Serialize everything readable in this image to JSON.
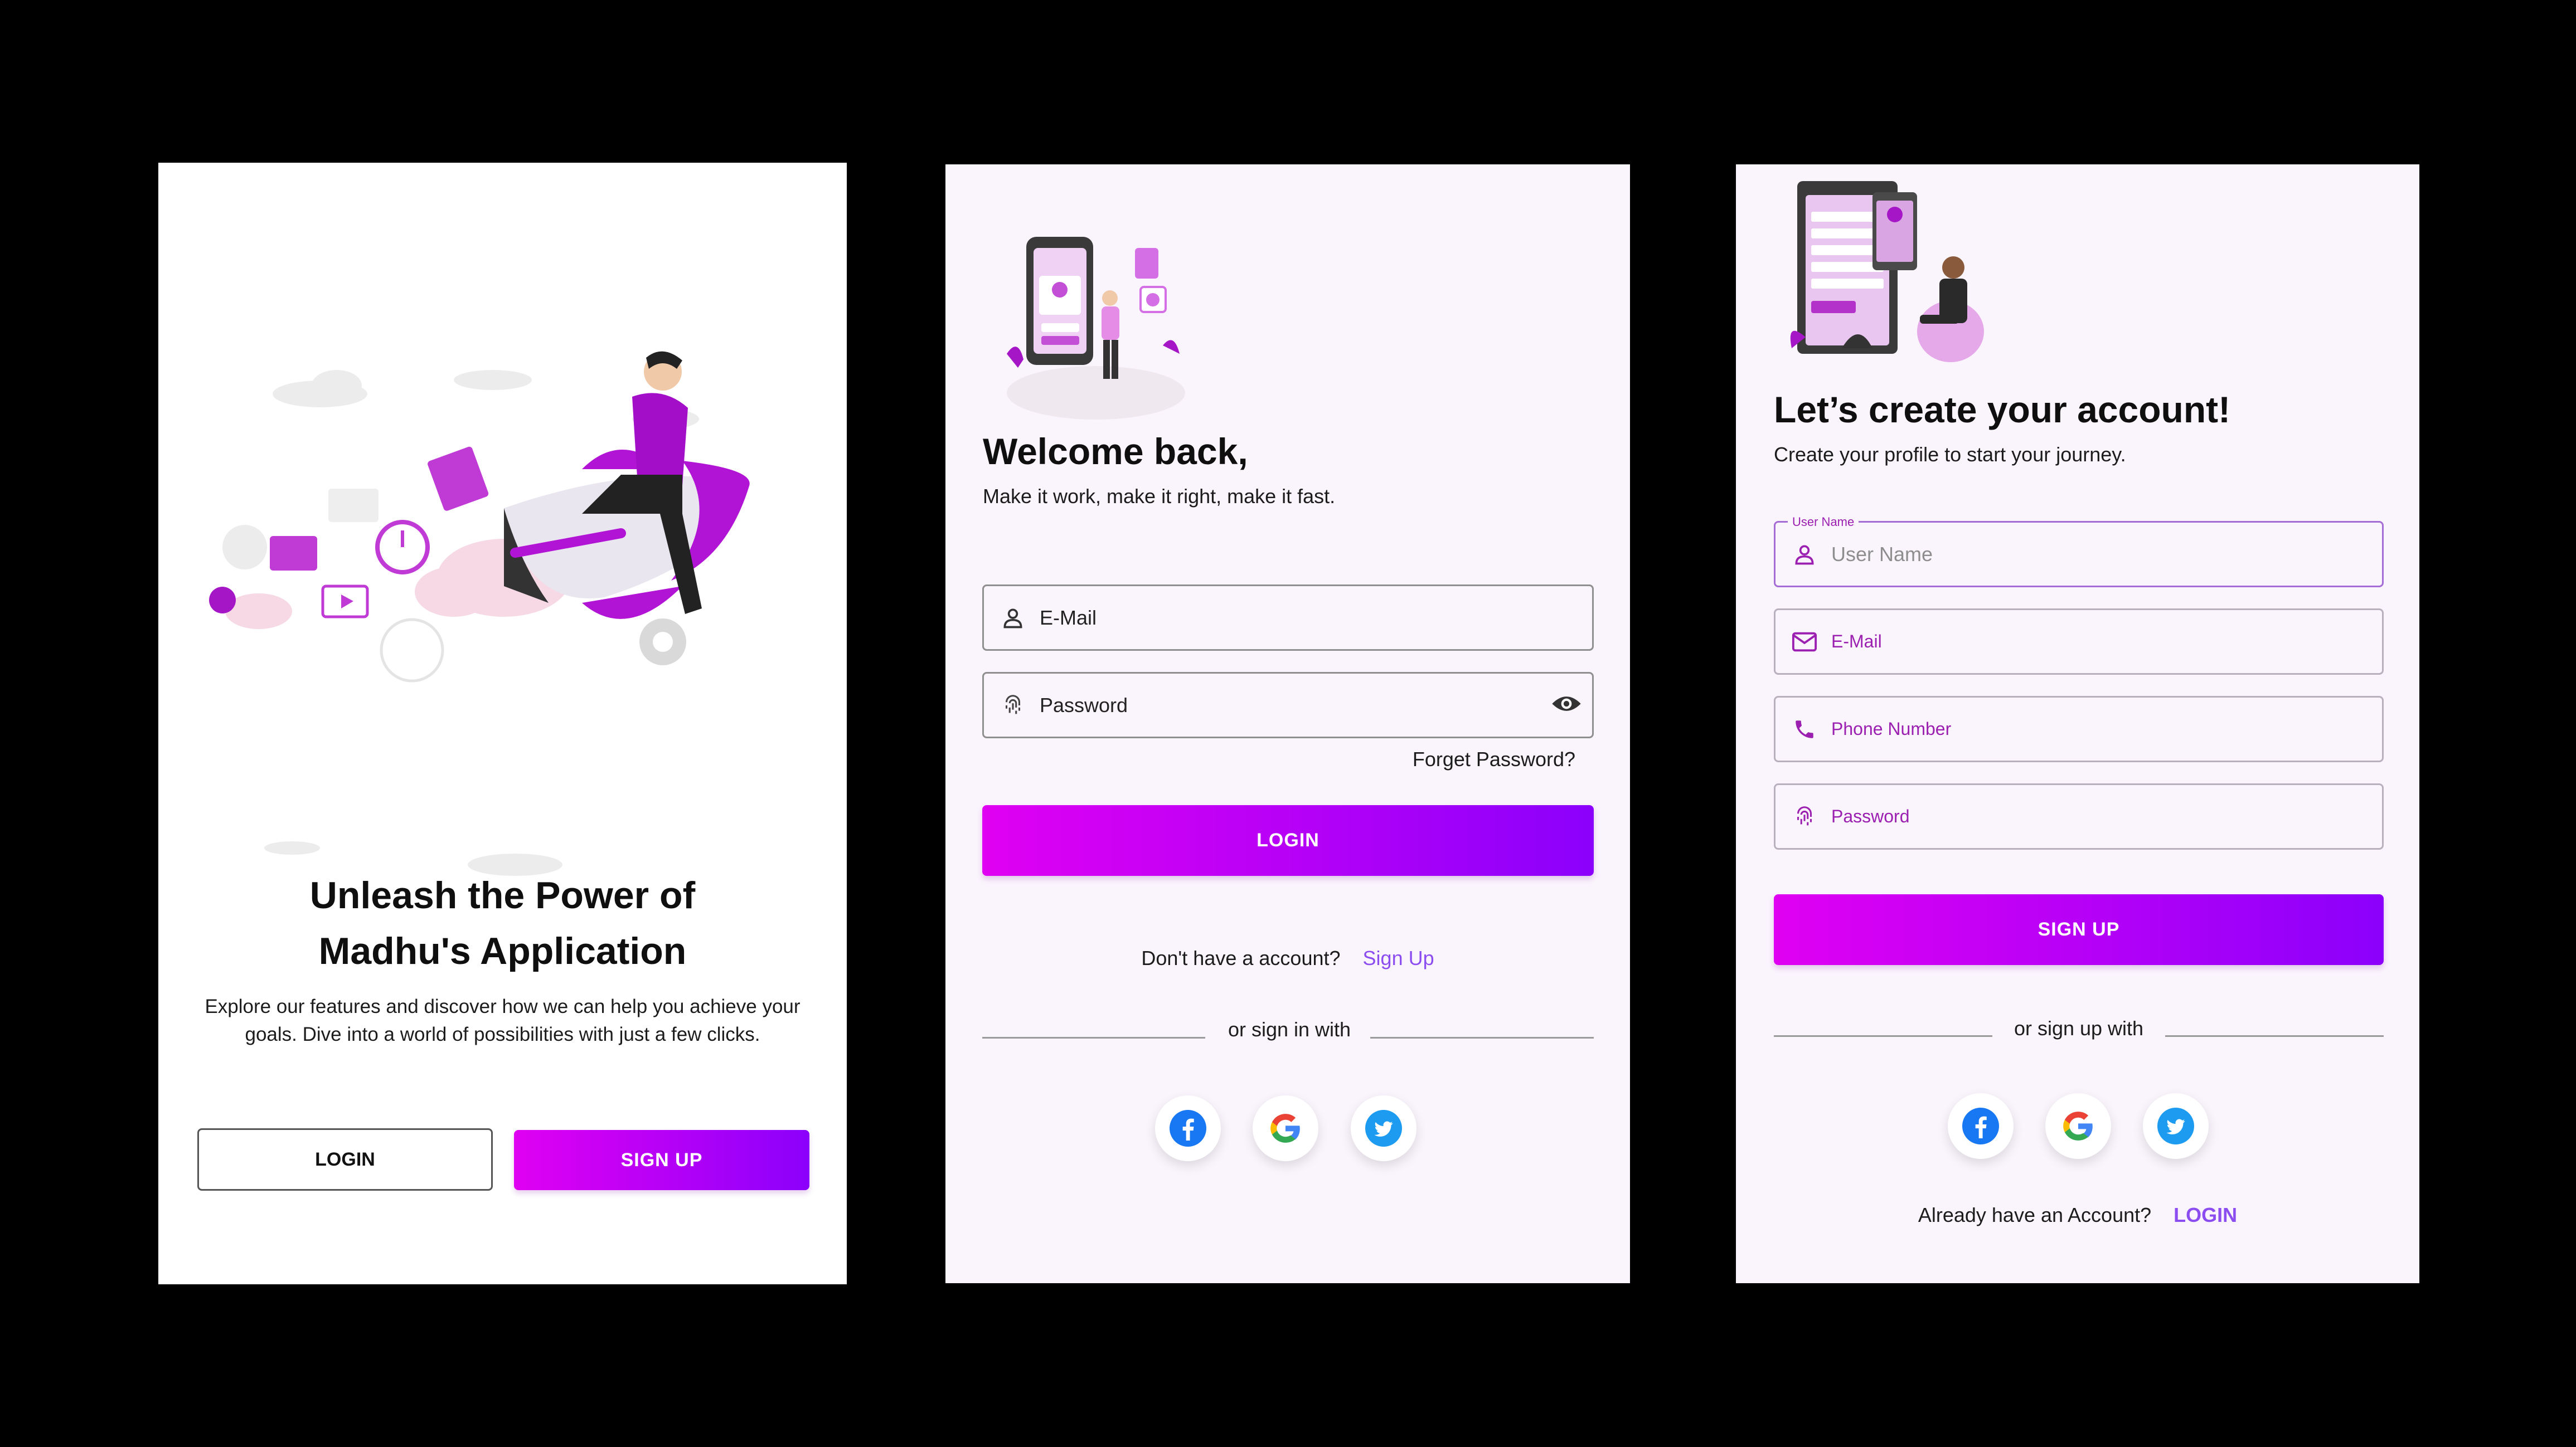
{
  "welcome_screen": {
    "title_line1": "Unleash the Power of",
    "title_line2": "Madhu's Application",
    "description": "Explore our features and discover how we can help you achieve your goals. Dive into a world of possibilities with just a few clicks.",
    "login_button": "LOGIN",
    "signup_button": "SIGN UP",
    "illustration": "rocket-rider-illustration"
  },
  "login_screen": {
    "title": "Welcome back,",
    "subtitle": "Make it work, make it right, make it fast.",
    "email_placeholder": "E-Mail",
    "password_placeholder": "Password",
    "forget_password": "Forget Password?",
    "login_button": "LOGIN",
    "no_account_text": "Don't have a account?",
    "signup_link": "Sign Up",
    "divider_text": "or sign in with",
    "social": [
      "facebook-icon",
      "google-icon",
      "twitter-icon"
    ],
    "illustration": "mobile-login-illustration"
  },
  "signup_screen": {
    "title": "Let’s create your account!",
    "subtitle": "Create your profile to start your journey.",
    "username_floating_label": "User Name",
    "username_placeholder": "User Name",
    "email_placeholder": "E-Mail",
    "phone_placeholder": "Phone Number",
    "password_placeholder": "Password",
    "signup_button": "SIGN UP",
    "divider_text": "or sign up with",
    "have_account_text": "Already have an Account?",
    "login_link": "LOGIN",
    "social": [
      "facebook-icon",
      "google-icon",
      "twitter-icon"
    ],
    "illustration": "profile-form-illustration"
  },
  "colors": {
    "accent_start": "#e000f2",
    "accent_end": "#8b00fb",
    "link": "#8b4cf0",
    "field_label": "#9b1fb0",
    "screen_bg": "#faf4fc"
  }
}
